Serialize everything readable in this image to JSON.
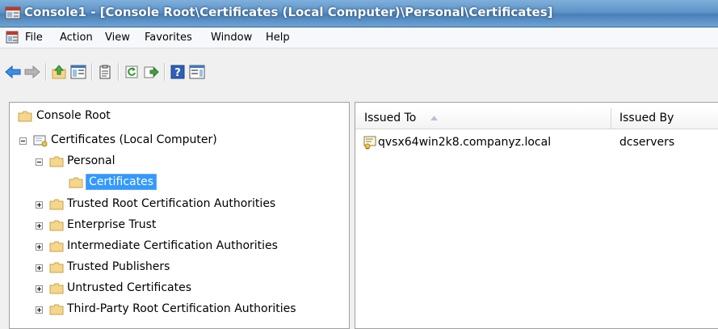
{
  "window": {
    "title": "Console1 - [Console Root\\Certificates (Local Computer)\\Personal\\Certificates]"
  },
  "menu": {
    "items": [
      "File",
      "Action",
      "View",
      "Favorites",
      "Window",
      "Help"
    ]
  },
  "toolbar": {
    "buttons": [
      "back-icon",
      "forward-icon",
      "up-one-level-icon",
      "show-hide-console-tree-icon",
      "properties-icon",
      "refresh-icon",
      "export-list-icon",
      "help-icon",
      "show-hide-action-pane-icon"
    ]
  },
  "tree": {
    "root": "Console Root",
    "store": "Certificates (Local Computer)",
    "personal": "Personal",
    "certificates": "Certificates",
    "children": [
      "Trusted Root Certification Authorities",
      "Enterprise Trust",
      "Intermediate Certification Authorities",
      "Trusted Publishers",
      "Untrusted Certificates",
      "Third-Party Root Certification Authorities"
    ]
  },
  "list": {
    "columns": [
      "Issued To",
      "Issued By"
    ],
    "rows": [
      {
        "issued_to": "qvsx64win2k8.companyz.local",
        "issued_by": "dcservers"
      }
    ]
  },
  "colors": {
    "selection": "#3399ff",
    "folder": "#f5d68a",
    "title_bar": "#5d93c7"
  }
}
